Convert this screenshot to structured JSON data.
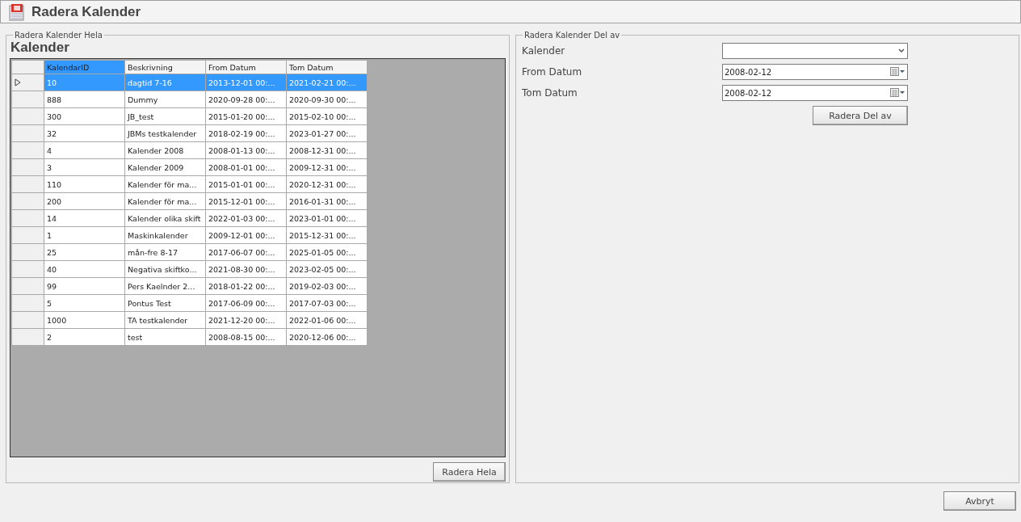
{
  "window": {
    "title": "Radera Kalender"
  },
  "whole_group": {
    "legend": "Radera Kalender Hela",
    "heading": "Kalender",
    "table": {
      "columns": [
        {
          "label": "KalendarID",
          "selected": true
        },
        {
          "label": "Beskrivning",
          "selected": false
        },
        {
          "label": "From Datum",
          "selected": false
        },
        {
          "label": "Tom Datum",
          "selected": false
        }
      ],
      "rows": [
        {
          "cells": [
            "10",
            "dagtid 7-16",
            "2013-12-01 00:...",
            "2021-02-21 00:..."
          ],
          "selected": true
        },
        {
          "cells": [
            "888",
            "Dummy",
            "2020-09-28 00:...",
            "2020-09-30 00:..."
          ],
          "selected": false
        },
        {
          "cells": [
            "300",
            "JB_test",
            "2015-01-20 00:...",
            "2015-02-10 00:..."
          ],
          "selected": false
        },
        {
          "cells": [
            "32",
            "JBMs testkalender",
            "2018-02-19 00:...",
            "2023-01-27 00:..."
          ],
          "selected": false
        },
        {
          "cells": [
            "4",
            "Kalender 2008",
            "2008-01-13 00:...",
            "2008-12-31 00:..."
          ],
          "selected": false
        },
        {
          "cells": [
            "3",
            "Kalender 2009",
            "2008-01-01 00:...",
            "2009-12-31 00:..."
          ],
          "selected": false
        },
        {
          "cells": [
            "110",
            "Kalender för ma...",
            "2015-01-01 00:...",
            "2020-12-31 00:..."
          ],
          "selected": false
        },
        {
          "cells": [
            "200",
            "Kalender för ma...",
            "2015-12-01 00:...",
            "2016-01-31 00:..."
          ],
          "selected": false
        },
        {
          "cells": [
            "14",
            "Kalender olika skift",
            "2022-01-03 00:...",
            "2023-01-01 00:..."
          ],
          "selected": false
        },
        {
          "cells": [
            "1",
            "Maskinkalender",
            "2009-12-01 00:...",
            "2015-12-31 00:..."
          ],
          "selected": false
        },
        {
          "cells": [
            "25",
            "mån-fre 8-17",
            "2017-06-07 00:...",
            "2025-01-05 00:..."
          ],
          "selected": false
        },
        {
          "cells": [
            "40",
            "Negativa skiftko...",
            "2021-08-30 00:...",
            "2023-02-05 00:..."
          ],
          "selected": false
        },
        {
          "cells": [
            "99",
            "Pers Kaelnder 2...",
            "2018-01-22 00:...",
            "2019-02-03 00:..."
          ],
          "selected": false
        },
        {
          "cells": [
            "5",
            "Pontus Test",
            "2017-06-09 00:...",
            "2017-07-03 00:..."
          ],
          "selected": false
        },
        {
          "cells": [
            "1000",
            "TA testkalender",
            "2021-12-20 00:...",
            "2022-01-06 00:..."
          ],
          "selected": false
        },
        {
          "cells": [
            "2",
            "test",
            "2008-08-15 00:...",
            "2020-12-06 00:..."
          ],
          "selected": false
        }
      ]
    },
    "button": "Radera Hela"
  },
  "part_group": {
    "legend": "Radera Kalender Del av",
    "fields": [
      {
        "kind": "dropdown",
        "label": "Kalender"
      },
      {
        "kind": "date",
        "label": "From Datum",
        "value": "2008-02-12"
      },
      {
        "kind": "date",
        "label": "Tom Datum",
        "value": "2008-02-12"
      }
    ],
    "button": "Radera Del av"
  },
  "cancel_button": "Avbryt"
}
